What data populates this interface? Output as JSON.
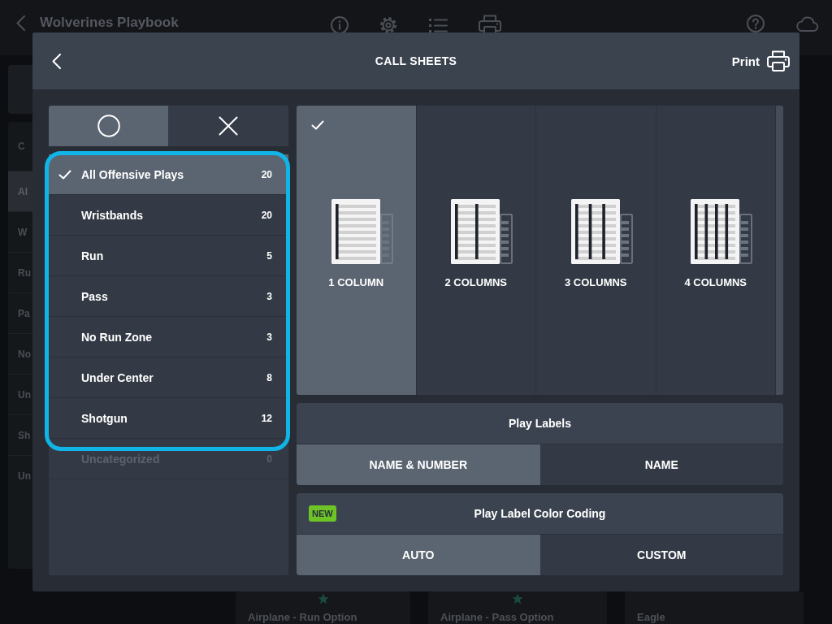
{
  "app": {
    "title": "Wolverines Playbook",
    "sidebar_header": "C",
    "sidebar_items": [
      {
        "label": "Al",
        "selected": true
      },
      {
        "label": "W",
        "selected": false
      },
      {
        "label": "Ru",
        "selected": false
      },
      {
        "label": "Pa",
        "selected": false
      },
      {
        "label": "No",
        "selected": false
      },
      {
        "label": "Un",
        "selected": false
      },
      {
        "label": "Sh",
        "selected": false
      },
      {
        "label": "Un",
        "selected": false
      }
    ],
    "cards": [
      {
        "title": "Airplane - Run Option",
        "starred": true
      },
      {
        "title": "Airplane - Pass Option",
        "starred": true
      },
      {
        "title": "Eagle",
        "starred": false
      }
    ]
  },
  "dialog": {
    "title": "CALL SHEETS",
    "print_label": "Print"
  },
  "filter_tabs": [
    {
      "kind": "circle",
      "selected": true
    },
    {
      "kind": "cross",
      "selected": false
    }
  ],
  "categories": [
    {
      "name": "All Offensive Plays",
      "count": "20",
      "selected": true,
      "disabled": false
    },
    {
      "name": "Wristbands",
      "count": "20",
      "selected": false,
      "disabled": false
    },
    {
      "name": "Run",
      "count": "5",
      "selected": false,
      "disabled": false
    },
    {
      "name": "Pass",
      "count": "3",
      "selected": false,
      "disabled": false
    },
    {
      "name": "No Run Zone",
      "count": "3",
      "selected": false,
      "disabled": false
    },
    {
      "name": "Under Center",
      "count": "8",
      "selected": false,
      "disabled": false
    },
    {
      "name": "Shotgun",
      "count": "12",
      "selected": false,
      "disabled": false
    },
    {
      "name": "Uncategorized",
      "count": "0",
      "selected": false,
      "disabled": true
    }
  ],
  "layouts": [
    {
      "label": "1 COLUMN",
      "selected": true
    },
    {
      "label": "2 COLUMNS",
      "selected": false
    },
    {
      "label": "3 COLUMNS",
      "selected": false
    },
    {
      "label": "4 COLUMNS",
      "selected": false
    }
  ],
  "play_labels": {
    "title": "Play Labels",
    "options": [
      {
        "label": "NAME & NUMBER",
        "selected": true
      },
      {
        "label": "NAME",
        "selected": false
      }
    ]
  },
  "color_coding": {
    "badge": "NEW",
    "title": "Play Label Color Coding",
    "options": [
      {
        "label": "AUTO",
        "selected": true
      },
      {
        "label": "CUSTOM",
        "selected": false
      }
    ]
  }
}
